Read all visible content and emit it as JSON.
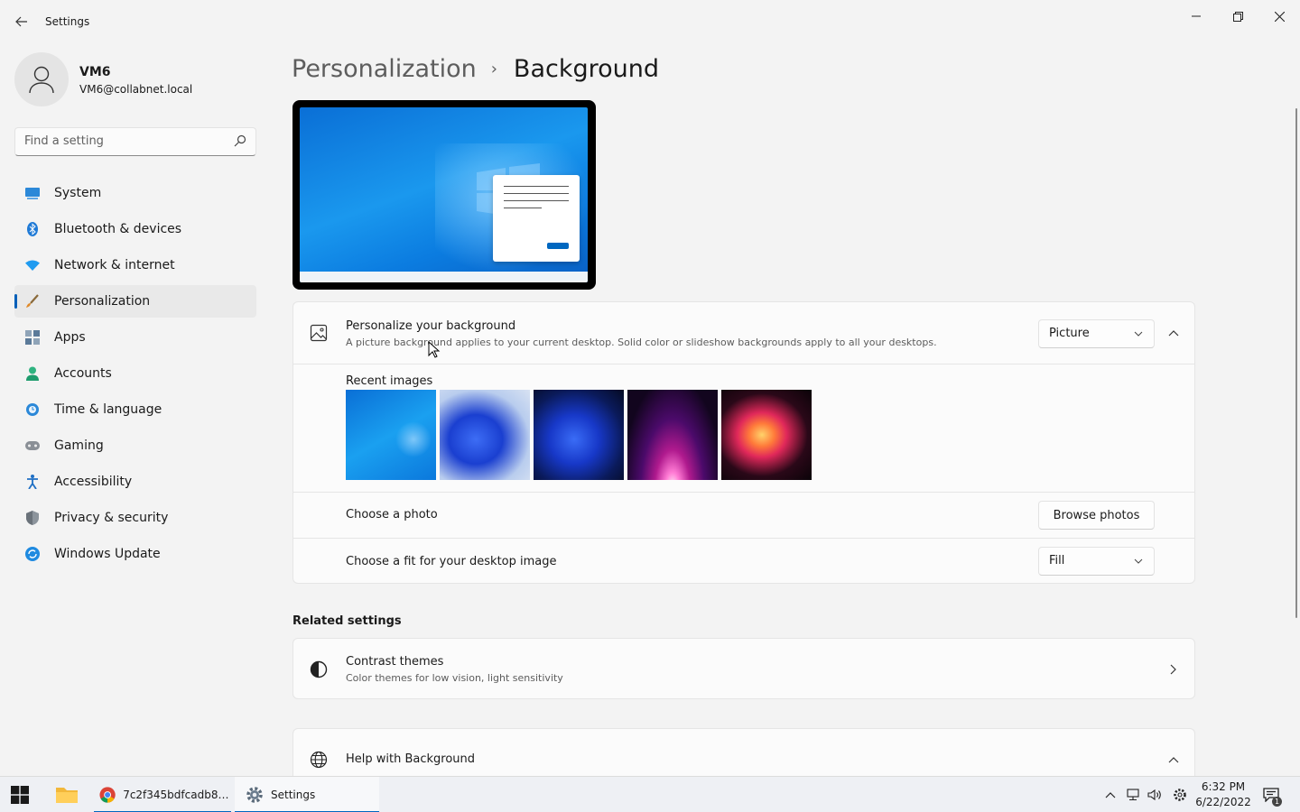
{
  "window": {
    "title": "Settings"
  },
  "user": {
    "name": "VM6",
    "email": "VM6@collabnet.local"
  },
  "search": {
    "placeholder": "Find a setting"
  },
  "sidebar": {
    "items": [
      {
        "label": "System",
        "icon": "system-icon"
      },
      {
        "label": "Bluetooth & devices",
        "icon": "bluetooth-icon"
      },
      {
        "label": "Network & internet",
        "icon": "wifi-icon"
      },
      {
        "label": "Personalization",
        "icon": "paintbrush-icon",
        "active": true
      },
      {
        "label": "Apps",
        "icon": "apps-icon"
      },
      {
        "label": "Accounts",
        "icon": "person-icon"
      },
      {
        "label": "Time & language",
        "icon": "clock-globe-icon"
      },
      {
        "label": "Gaming",
        "icon": "gamepad-icon"
      },
      {
        "label": "Accessibility",
        "icon": "accessibility-icon"
      },
      {
        "label": "Privacy & security",
        "icon": "shield-icon"
      },
      {
        "label": "Windows Update",
        "icon": "update-icon"
      }
    ]
  },
  "breadcrumb": {
    "parent": "Personalization",
    "separator": "›",
    "current": "Background"
  },
  "background": {
    "title": "Personalize your background",
    "subtitle": "A picture background applies to your current desktop. Solid color or slideshow backgrounds apply to all your desktops.",
    "type_value": "Picture",
    "recent_label": "Recent images",
    "choose_photo_label": "Choose a photo",
    "browse_label": "Browse photos",
    "fit_label": "Choose a fit for your desktop image",
    "fit_value": "Fill"
  },
  "related": {
    "title": "Related settings",
    "contrast_title": "Contrast themes",
    "contrast_sub": "Color themes for low vision, light sensitivity"
  },
  "help": {
    "title": "Help with Background"
  },
  "taskbar": {
    "chrome_label": "7c2f345bdfcadb8a3...",
    "settings_label": "Settings",
    "time": "6:32 PM",
    "date": "6/22/2022",
    "notification_count": "1"
  },
  "colors": {
    "accent": "#005fb8",
    "background": "#f3f3f3",
    "card": "#fbfbfb"
  }
}
